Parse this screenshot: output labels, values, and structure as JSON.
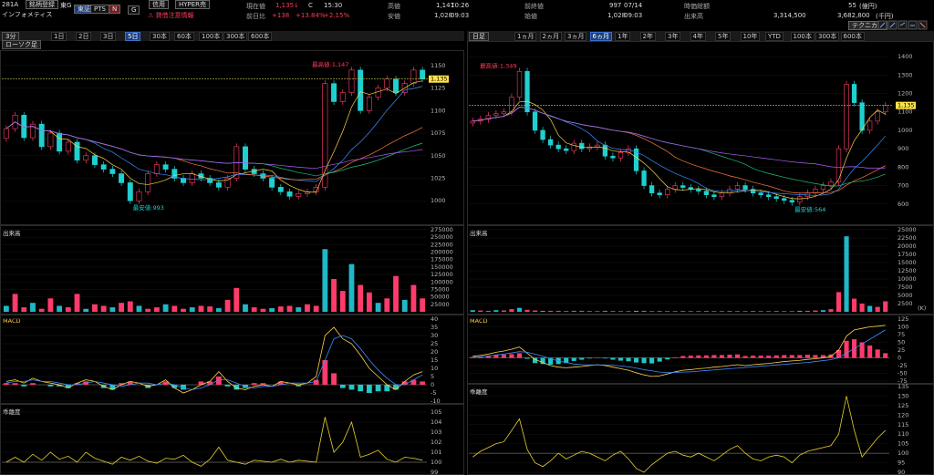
{
  "header": {
    "code": "281A",
    "register_btn": "銘柄登録",
    "market": "東G",
    "exchange_btn": "東証",
    "pts_btn": "PTS",
    "name": "インフォメティス",
    "margin_btn": "信用",
    "hyper_btn": "HYPER売",
    "warning": "⚠ 貸借注意情報",
    "price_label": "現在値",
    "price": "1,135",
    "price_mark": "↓",
    "status": "C",
    "time": "15:30",
    "change_label": "前日比",
    "change": "+138",
    "change_pct": "+13.84%",
    "change_pct2": "+2.15%",
    "high_label": "高値",
    "high": "1,147",
    "high_time": "10:26",
    "low_label": "安値",
    "low": "1,028",
    "low_time": "09:03",
    "prev_label": "前終値",
    "prev": "997",
    "prev_date": "07/14",
    "open_label": "始値",
    "open": "1,028",
    "open_time": "09:03",
    "mcap_label": "時価総額",
    "mcap": "55",
    "mcap_unit": "(億円)",
    "vol_label": "出来高",
    "vol": "3,314,500",
    "turnover": "3,682,800",
    "turnover_unit": "(千円)",
    "tech_btn": "テクニカル"
  },
  "left_toolbar": {
    "interval": "3分",
    "candle": "ローソク足",
    "ranges": [
      "1日",
      "2日",
      "3日",
      "5日",
      "30本",
      "60本",
      "100本",
      "300本",
      "600本"
    ],
    "selected": 3
  },
  "right_toolbar": {
    "interval": "日足",
    "ranges": [
      "1ヵ月",
      "2ヵ月",
      "3ヵ月",
      "6ヵ月",
      "1年",
      "2年",
      "3年",
      "4年",
      "5年",
      "10年",
      "YTD",
      "100本",
      "300本",
      "600本"
    ],
    "selected": 3
  },
  "sections": {
    "volume": "出来高",
    "macd": "MACD",
    "deviation": "乖離度"
  },
  "chart_data": [
    {
      "type": "candlestick",
      "panel": "intraday-3min-price",
      "ylim": [
        980,
        1160
      ],
      "yticks": [
        1000,
        1025,
        1050,
        1075,
        1100,
        1125,
        1150
      ],
      "current_price": 1135,
      "current_label": "1,135",
      "high_annotation": "最高値:1,147",
      "low_annotation": "最安値:993",
      "close_path": [
        1080,
        1095,
        1070,
        1085,
        1060,
        1075,
        1055,
        1065,
        1045,
        1050,
        1040,
        1035,
        1030,
        1020,
        1000,
        1010,
        1030,
        1040,
        1035,
        1025,
        1020,
        1030,
        1025,
        1020,
        1015,
        1025,
        1060,
        1035,
        1030,
        1025,
        1015,
        1010,
        1005,
        1008,
        1010,
        1015,
        1130,
        1110,
        1120,
        1145,
        1100,
        1115,
        1125,
        1135,
        1120,
        1130,
        1145,
        1135
      ]
    },
    {
      "type": "bar",
      "panel": "intraday-volume",
      "ylim": [
        0,
        275000
      ],
      "yticks": [
        25000,
        50000,
        75000,
        100000,
        125000,
        150000,
        175000,
        200000,
        225000,
        250000,
        275000
      ],
      "values": [
        20000,
        60000,
        15000,
        30000,
        10000,
        45000,
        20000,
        15000,
        60000,
        10000,
        25000,
        20000,
        15000,
        30000,
        35000,
        20000,
        10000,
        15000,
        25000,
        20000,
        10000,
        15000,
        20000,
        18000,
        12000,
        40000,
        80000,
        25000,
        15000,
        10000,
        12000,
        18000,
        20000,
        15000,
        25000,
        20000,
        210000,
        110000,
        70000,
        160000,
        90000,
        65000,
        30000,
        45000,
        120000,
        40000,
        90000,
        45000
      ]
    },
    {
      "type": "line",
      "panel": "intraday-macd",
      "ylim": [
        -10,
        40
      ],
      "yticks": [
        -10,
        -5,
        0,
        5,
        10,
        15,
        20,
        25,
        30,
        35,
        40
      ],
      "macd": [
        2,
        3,
        1,
        4,
        2,
        1,
        0,
        -2,
        1,
        3,
        2,
        -1,
        -3,
        0,
        2,
        1,
        -1,
        0,
        3,
        -2,
        -5,
        -3,
        0,
        2,
        8,
        2,
        -2,
        -3,
        -1,
        0,
        -1,
        2,
        1,
        0,
        1,
        5,
        30,
        35,
        28,
        25,
        18,
        10,
        5,
        0,
        -3,
        2,
        6,
        8
      ],
      "signal": [
        1,
        2,
        2,
        3,
        2,
        2,
        1,
        0,
        0,
        1,
        2,
        1,
        0,
        -1,
        0,
        1,
        1,
        0,
        1,
        0,
        -2,
        -3,
        -2,
        0,
        3,
        3,
        1,
        -1,
        -2,
        -1,
        -1,
        0,
        1,
        1,
        1,
        2,
        15,
        28,
        30,
        28,
        22,
        15,
        9,
        4,
        0,
        0,
        3,
        6
      ],
      "hist": [
        1,
        1,
        -1,
        1,
        0,
        -1,
        -1,
        -2,
        1,
        2,
        0,
        -2,
        -3,
        1,
        2,
        0,
        -2,
        0,
        2,
        -2,
        -3,
        0,
        2,
        2,
        5,
        -1,
        -3,
        -2,
        1,
        1,
        0,
        2,
        0,
        -1,
        0,
        3,
        15,
        7,
        -2,
        -3,
        -4,
        -5,
        -4,
        -4,
        -3,
        2,
        3,
        2
      ]
    },
    {
      "type": "line",
      "panel": "intraday-deviation",
      "ylim": [
        99,
        105
      ],
      "yticks": [
        99,
        100,
        101,
        102,
        103,
        104,
        105
      ],
      "values": [
        100,
        100.5,
        100,
        100.8,
        100.2,
        101,
        100.3,
        100.6,
        100,
        101,
        100.4,
        100.1,
        99.8,
        100.5,
        100.2,
        100.6,
        100.1,
        99.9,
        100.4,
        100.3,
        100.7,
        100,
        99.6,
        100.3,
        101.5,
        100.2,
        100,
        99.8,
        100.2,
        100.1,
        100,
        100.3,
        100,
        100.2,
        100.1,
        100,
        104.5,
        101,
        102,
        104,
        100.5,
        100.8,
        101.2,
        100.3,
        100,
        100.5,
        100.4,
        100.2
      ]
    },
    {
      "type": "candlestick",
      "panel": "daily-price",
      "ylim": [
        500,
        1450
      ],
      "yticks": [
        600,
        700,
        800,
        900,
        1000,
        1100,
        1200,
        1300,
        1400
      ],
      "current_price": 1135,
      "current_label": "1,135",
      "high_annotation": "最高値:1,349",
      "low_annotation": "最安値:564",
      "close_path": [
        1050,
        1060,
        1080,
        1090,
        1100,
        1180,
        1320,
        1100,
        1000,
        950,
        920,
        900,
        890,
        930,
        900,
        910,
        920,
        860,
        850,
        880,
        900,
        780,
        700,
        660,
        650,
        680,
        700,
        690,
        680,
        670,
        650,
        640,
        660,
        680,
        700,
        680,
        660,
        650,
        640,
        630,
        620,
        610,
        640,
        660,
        680,
        700,
        720,
        900,
        1250,
        1150,
        1000,
        1050,
        1100,
        1135
      ]
    },
    {
      "type": "bar",
      "panel": "daily-volume",
      "ylim": [
        0,
        25000
      ],
      "yticks": [
        2500,
        5000,
        7500,
        10000,
        12500,
        15000,
        17500,
        20000,
        22500,
        25000
      ],
      "unit": "(K)",
      "values": [
        500,
        400,
        300,
        500,
        400,
        800,
        1200,
        600,
        400,
        300,
        300,
        300,
        200,
        300,
        300,
        200,
        200,
        300,
        200,
        200,
        200,
        300,
        300,
        200,
        200,
        200,
        200,
        200,
        200,
        200,
        200,
        200,
        200,
        200,
        200,
        200,
        200,
        200,
        200,
        200,
        200,
        200,
        300,
        300,
        400,
        500,
        800,
        6000,
        23000,
        4000,
        2500,
        1800,
        1500,
        3200
      ]
    },
    {
      "type": "line",
      "panel": "daily-macd",
      "ylim": [
        -75,
        125
      ],
      "yticks": [
        -75,
        -50,
        -25,
        0,
        25,
        50,
        75,
        100,
        125
      ],
      "macd": [
        5,
        8,
        12,
        18,
        22,
        28,
        35,
        15,
        -5,
        -15,
        -25,
        -30,
        -32,
        -30,
        -28,
        -25,
        -22,
        -25,
        -30,
        -35,
        -40,
        -48,
        -55,
        -60,
        -58,
        -52,
        -45,
        -40,
        -38,
        -35,
        -33,
        -30,
        -28,
        -25,
        -22,
        -25,
        -22,
        -20,
        -18,
        -15,
        -12,
        -10,
        -8,
        -5,
        -3,
        0,
        5,
        25,
        70,
        90,
        95,
        100,
        102,
        105
      ],
      "signal": [
        2,
        4,
        6,
        9,
        12,
        16,
        20,
        18,
        12,
        5,
        -3,
        -10,
        -15,
        -20,
        -22,
        -23,
        -23,
        -23,
        -24,
        -26,
        -29,
        -33,
        -38,
        -42,
        -46,
        -47,
        -47,
        -46,
        -45,
        -43,
        -41,
        -39,
        -37,
        -35,
        -33,
        -31,
        -29,
        -27,
        -25,
        -23,
        -21,
        -19,
        -17,
        -15,
        -12,
        -9,
        -6,
        0,
        15,
        30,
        45,
        60,
        75,
        90
      ],
      "hist": [
        3,
        4,
        6,
        9,
        10,
        12,
        15,
        -3,
        -17,
        -20,
        -22,
        -20,
        -17,
        -10,
        -6,
        -2,
        1,
        -2,
        -6,
        -9,
        -11,
        -15,
        -17,
        -18,
        -12,
        -5,
        2,
        6,
        7,
        8,
        8,
        9,
        9,
        10,
        11,
        6,
        7,
        7,
        7,
        8,
        9,
        9,
        9,
        10,
        9,
        9,
        11,
        25,
        55,
        60,
        50,
        40,
        27,
        15
      ]
    },
    {
      "type": "line",
      "panel": "daily-deviation",
      "ylim": [
        90,
        135
      ],
      "yticks": [
        90,
        95,
        100,
        105,
        110,
        115,
        120,
        125,
        130,
        135
      ],
      "values": [
        98,
        101,
        103,
        105,
        106,
        112,
        118,
        102,
        95,
        93,
        96,
        100,
        97,
        99,
        101,
        100,
        98,
        96,
        99,
        101,
        97,
        92,
        90,
        94,
        97,
        100,
        101,
        99,
        98,
        100,
        98,
        96,
        99,
        102,
        104,
        100,
        97,
        96,
        98,
        99,
        98,
        95,
        99,
        101,
        102,
        103,
        104,
        110,
        130,
        112,
        98,
        103,
        108,
        112
      ]
    }
  ]
}
